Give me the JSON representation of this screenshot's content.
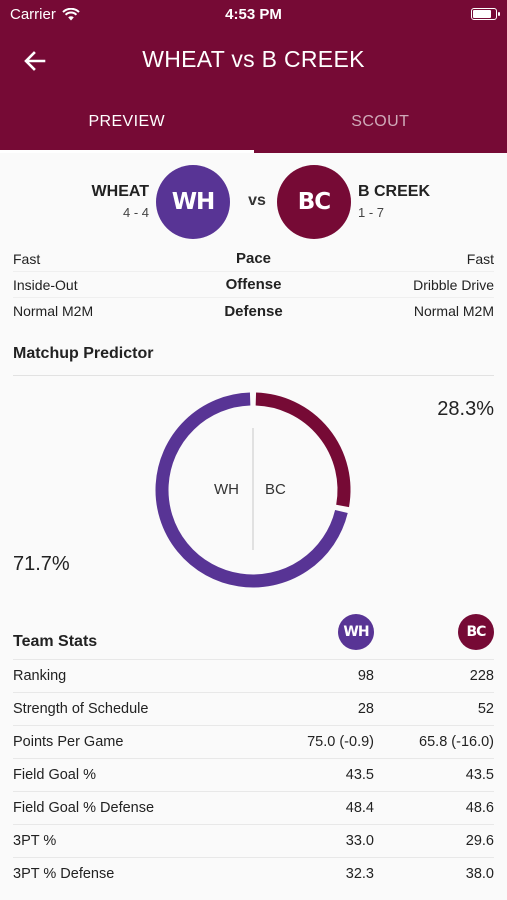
{
  "status_bar": {
    "carrier": "Carrier",
    "time": "4:53 PM"
  },
  "app_bar": {
    "title": "WHEAT vs B CREEK"
  },
  "tabs": [
    {
      "label": "PREVIEW"
    },
    {
      "label": "SCOUT"
    }
  ],
  "matchup": {
    "home": {
      "name": "WHEAT",
      "record": "4 - 4",
      "abbr": "WH",
      "color": "#583495"
    },
    "vs_label": "vs",
    "away": {
      "name": "B CREEK",
      "record": "1 - 7",
      "abbr": "BC",
      "color": "#760a35"
    }
  },
  "comparison": [
    {
      "left": "Fast",
      "label": "Pace",
      "right": "Fast"
    },
    {
      "left": "Inside-Out",
      "label": "Offense",
      "right": "Dribble Drive"
    },
    {
      "left": "Normal M2M",
      "label": "Defense",
      "right": "Normal M2M"
    }
  ],
  "predictor": {
    "title": "Matchup Predictor",
    "home_pct": 71.7,
    "away_pct": 28.3,
    "home_pct_label": "71.7%",
    "away_pct_label": "28.3%",
    "home_label": "WH",
    "away_label": "BC"
  },
  "team_stats": {
    "title": "Team Stats",
    "home_abbr": "WH",
    "away_abbr": "BC",
    "rows": [
      {
        "label": "Ranking",
        "home": "98",
        "away": "228"
      },
      {
        "label": "Strength of Schedule",
        "home": "28",
        "away": "52"
      },
      {
        "label": "Points Per Game",
        "home": "75.0 (-0.9)",
        "away": "65.8 (-16.0)"
      },
      {
        "label": "Field Goal %",
        "home": "43.5",
        "away": "43.5"
      },
      {
        "label": "Field Goal % Defense",
        "home": "48.4",
        "away": "48.6"
      },
      {
        "label": "3PT %",
        "home": "33.0",
        "away": "29.6"
      },
      {
        "label": "3PT % Defense",
        "home": "32.3",
        "away": "38.0"
      }
    ]
  }
}
